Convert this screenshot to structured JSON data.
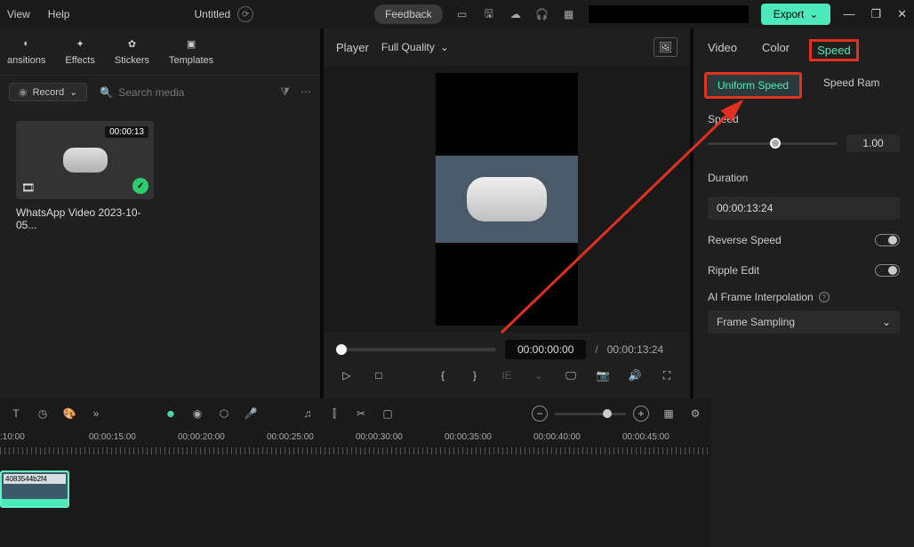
{
  "menu": {
    "view": "View",
    "help": "Help"
  },
  "title": "Untitled",
  "top": {
    "feedback": "Feedback",
    "export": "Export"
  },
  "tools": {
    "transitions": "ansitions",
    "effects": "Effects",
    "stickers": "Stickers",
    "templates": "Templates"
  },
  "media": {
    "record": "Record",
    "search_placeholder": "Search media",
    "thumb_duration": "00:00:13",
    "thumb_label": "WhatsApp Video 2023-10-05..."
  },
  "player": {
    "label": "Player",
    "quality": "Full Quality",
    "current_time": "00:00:00:00",
    "total_time": "00:00:13:24"
  },
  "right": {
    "tabs": {
      "video": "Video",
      "color": "Color",
      "speed": "Speed"
    },
    "sub_tabs": {
      "uniform": "Uniform Speed",
      "ramp": "Speed Ram"
    },
    "speed_label": "Speed",
    "speed_value": "1.00",
    "duration_label": "Duration",
    "duration_value": "00:00:13:24",
    "reverse": "Reverse Speed",
    "ripple": "Ripple Edit",
    "ai_label": "AI Frame Interpolation",
    "frame_option": "Frame Sampling"
  },
  "timeline": {
    "ticks": [
      ":10:00",
      "00:00:15:00",
      "00:00:20:00",
      "00:00:25:00",
      "00:00:30:00",
      "00:00:35:00",
      "00:00:40:00",
      "00:00:45:00"
    ],
    "clip_label": "4083544b2f4"
  }
}
